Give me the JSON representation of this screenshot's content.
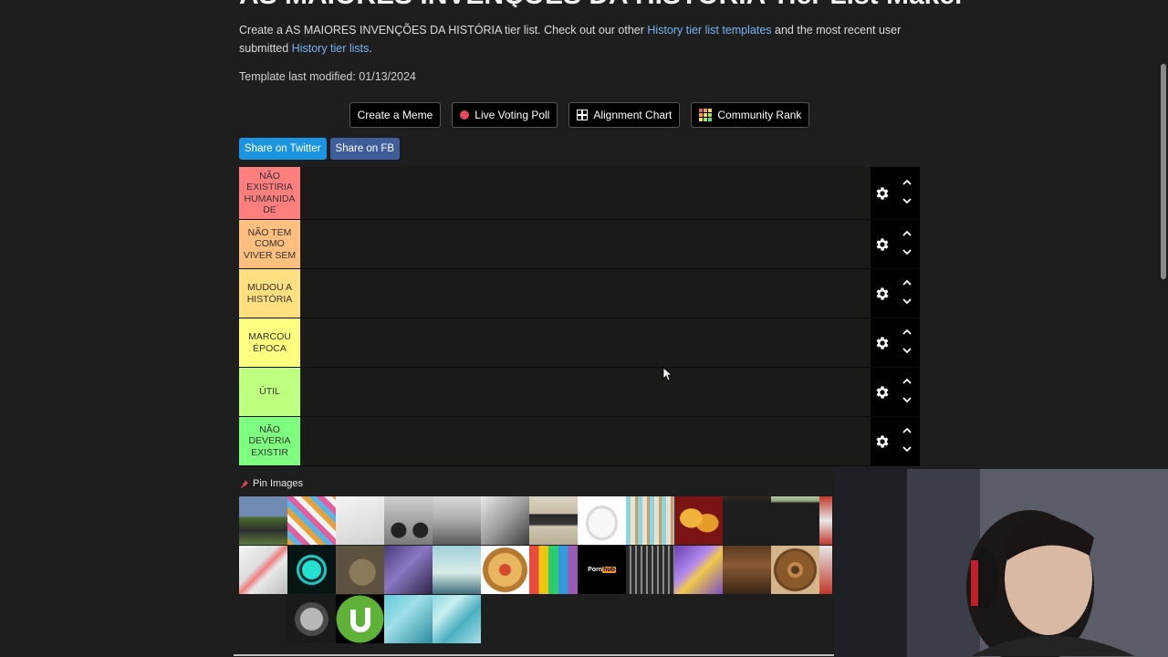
{
  "page": {
    "title": "AS MAIORES INVENÇÕES DA HISTÓRIA Tier List Maker",
    "intro_prefix": "Create a AS MAIORES INVENÇÕES DA HISTÓRIA tier list. Check out our other ",
    "intro_link1": "History tier list templates",
    "intro_middle": " and the most recent user submitted ",
    "intro_link2": "History tier lists",
    "intro_suffix": ".",
    "modified": "Template last modified: 01/13/2024"
  },
  "actions": {
    "meme": "Create a Meme",
    "poll": "Live Voting Poll",
    "alignment": "Alignment Chart",
    "community": "Community Rank"
  },
  "share": {
    "twitter": "Share on Twitter",
    "fb": "Share on FB"
  },
  "tiers": [
    {
      "label": "NÃO EXISTIRIA HUMANIDA DE",
      "color": "#ff7f7f"
    },
    {
      "label": "NÃO TEM COMO VIVER SEM",
      "color": "#ffbf7f"
    },
    {
      "label": "MUDOU A HISTÓRIA",
      "color": "#ffdf7f"
    },
    {
      "label": "MARCOU ÉPOCA",
      "color": "#ffff7f"
    },
    {
      "label": "ÚTIL",
      "color": "#bfff7f"
    },
    {
      "label": "NÃO DEVERIA EXISTIR",
      "color": "#7fff7f"
    }
  ],
  "pool": {
    "pin_label": "Pin Images",
    "tile_text": {
      "brand_left": "Porn",
      "brand_right": "hub"
    }
  },
  "colors": {
    "link": "#76b4f0",
    "twitter": "#1c95e0",
    "facebook": "#3f5d9a",
    "poll_dot": "#e2475e"
  }
}
